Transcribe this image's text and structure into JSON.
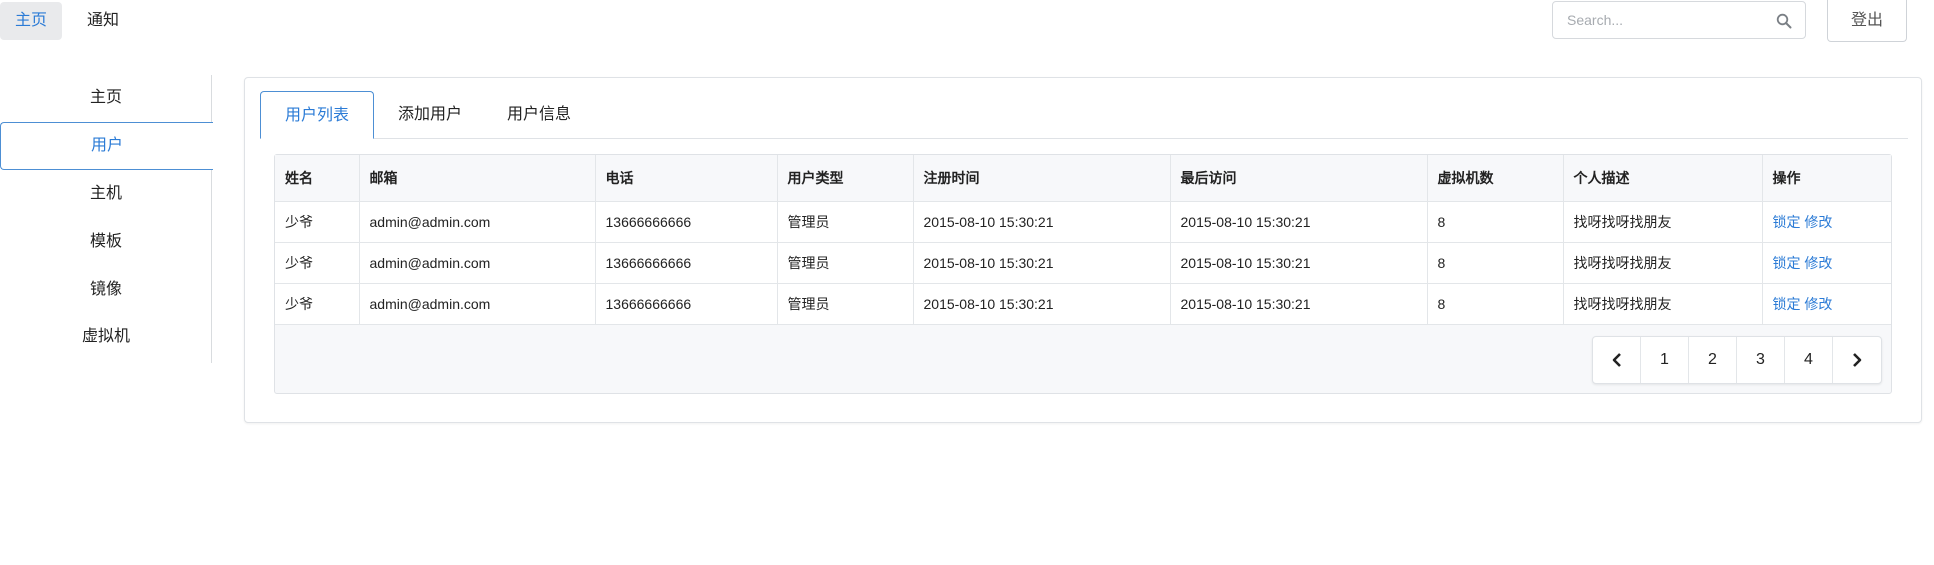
{
  "topnav": {
    "tabs": [
      {
        "label": "主页",
        "active": true
      },
      {
        "label": "通知",
        "active": false
      }
    ],
    "search": {
      "placeholder": "Search...",
      "value": "",
      "icon": "search-icon"
    },
    "logout_label": "登出"
  },
  "sidebar": {
    "items": [
      {
        "label": "主页",
        "active": false
      },
      {
        "label": "用户",
        "active": true
      },
      {
        "label": "主机",
        "active": false
      },
      {
        "label": "模板",
        "active": false
      },
      {
        "label": "镜像",
        "active": false
      },
      {
        "label": "虚拟机",
        "active": false
      }
    ]
  },
  "main": {
    "tabs": [
      {
        "label": "用户列表",
        "active": true
      },
      {
        "label": "添加用户",
        "active": false
      },
      {
        "label": "用户信息",
        "active": false
      }
    ],
    "table": {
      "columns": [
        "姓名",
        "邮箱",
        "电话",
        "用户类型",
        "注册时间",
        "最后访问",
        "虚拟机数",
        "个人描述",
        "操作"
      ],
      "rows": [
        {
          "name": "少爷",
          "email": "admin@admin.com",
          "phone": "13666666666",
          "type": "管理员",
          "registered": "2015-08-10 15:30:21",
          "last_visit": "2015-08-10 15:30:21",
          "vm_count": "8",
          "desc": "找呀找呀找朋友",
          "lock": "锁定",
          "edit": "修改"
        },
        {
          "name": "少爷",
          "email": "admin@admin.com",
          "phone": "13666666666",
          "type": "管理员",
          "registered": "2015-08-10 15:30:21",
          "last_visit": "2015-08-10 15:30:21",
          "vm_count": "8",
          "desc": "找呀找呀找朋友",
          "lock": "锁定",
          "edit": "修改"
        },
        {
          "name": "少爷",
          "email": "admin@admin.com",
          "phone": "13666666666",
          "type": "管理员",
          "registered": "2015-08-10 15:30:21",
          "last_visit": "2015-08-10 15:30:21",
          "vm_count": "8",
          "desc": "找呀找呀找朋友",
          "lock": "锁定",
          "edit": "修改"
        }
      ]
    },
    "pagination": {
      "pages": [
        "1",
        "2",
        "3",
        "4"
      ],
      "prev_icon": "chevron-left-icon",
      "next_icon": "chevron-right-icon"
    }
  },
  "colors": {
    "accent": "#2b7bd6",
    "border": "#dfe2e6",
    "active_tab_bg": "#e9eaec"
  }
}
